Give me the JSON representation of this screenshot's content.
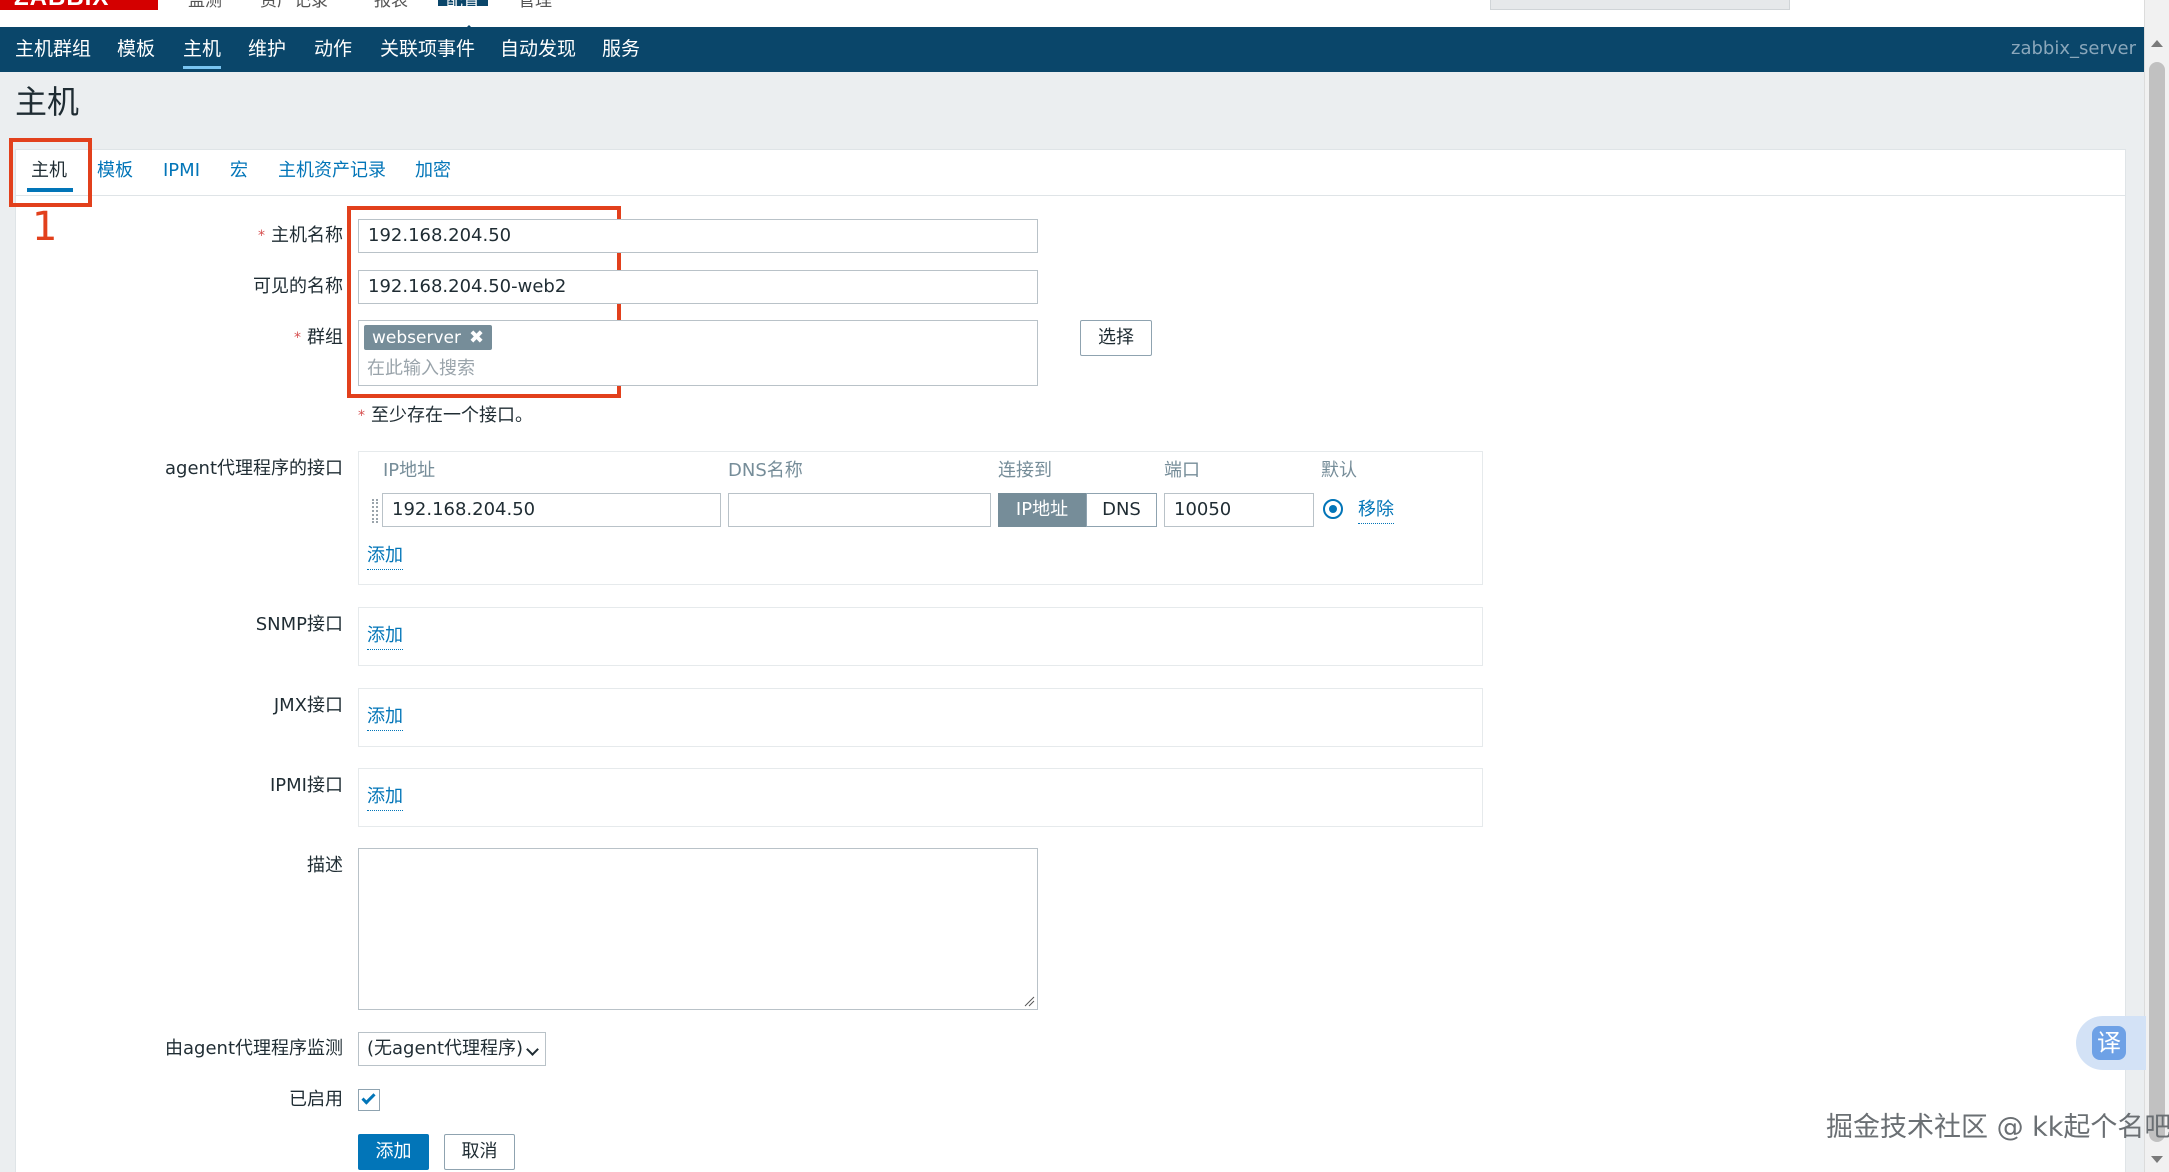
{
  "app": {
    "logo_text": "ZABBIX",
    "user": "zabbix_server"
  },
  "top_menu": [
    {
      "label": "监测"
    },
    {
      "label": "资产记录"
    },
    {
      "label": "报表"
    },
    {
      "label": "配置"
    },
    {
      "label": "管理"
    }
  ],
  "sub_nav": [
    {
      "label": "主机群组"
    },
    {
      "label": "模板"
    },
    {
      "label": "主机"
    },
    {
      "label": "维护"
    },
    {
      "label": "动作"
    },
    {
      "label": "关联项事件"
    },
    {
      "label": "自动发现"
    },
    {
      "label": "服务"
    }
  ],
  "page_title": "主机",
  "tabs": [
    {
      "label": "主机"
    },
    {
      "label": "模板"
    },
    {
      "label": "IPMI"
    },
    {
      "label": "宏"
    },
    {
      "label": "主机资产记录"
    },
    {
      "label": "加密"
    }
  ],
  "annotation_number": "1",
  "form": {
    "host_name": {
      "label": "主机名称",
      "value": "192.168.204.50"
    },
    "visible_name": {
      "label": "可见的名称",
      "value": "192.168.204.50-web2"
    },
    "groups": {
      "label": "群组",
      "chip": "webserver",
      "chip_remove": "✖",
      "placeholder": "在此输入搜索",
      "select_button": "选择"
    },
    "interface_note": "至少存在一个接口。",
    "agent_interface": {
      "label": "agent代理程序的接口",
      "col_ip": "IP地址",
      "col_dns": "DNS名称",
      "col_connect": "连接到",
      "col_port": "端口",
      "col_default": "默认",
      "ip_value": "192.168.204.50",
      "dns_value": "",
      "connect_ip": "IP地址",
      "connect_dns": "DNS",
      "port_value": "10050",
      "remove": "移除",
      "add": "添加"
    },
    "snmp_interface": {
      "label": "SNMP接口",
      "add": "添加"
    },
    "jmx_interface": {
      "label": "JMX接口",
      "add": "添加"
    },
    "ipmi_interface": {
      "label": "IPMI接口",
      "add": "添加"
    },
    "description": {
      "label": "描述",
      "value": ""
    },
    "proxy": {
      "label": "由agent代理程序监测",
      "value": "(无agent代理程序)"
    },
    "enabled": {
      "label": "已启用",
      "checked": true
    },
    "submit": "添加",
    "cancel": "取消"
  },
  "translate_button": "译",
  "watermark": "掘金技术社区 @ kk起个名吧",
  "colors": {
    "brand_red": "#d40000",
    "nav_bg": "#0a466a",
    "link": "#0275b8",
    "annotation": "#e2401c"
  }
}
